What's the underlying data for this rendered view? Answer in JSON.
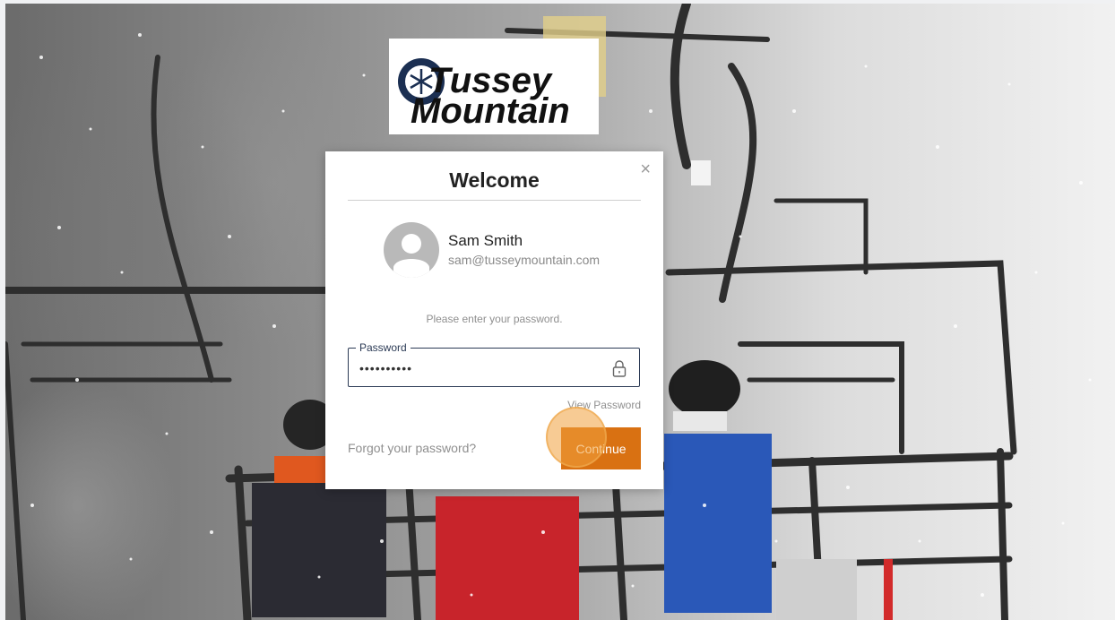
{
  "logo": {
    "line1": "Tussey",
    "line2": "Mountain"
  },
  "modal": {
    "title": "Welcome",
    "close_label": "×",
    "user": {
      "name": "Sam Smith",
      "email": "sam@tusseymountain.com"
    },
    "prompt": "Please enter your password.",
    "password": {
      "label": "Password",
      "value": "••••••••••"
    },
    "view_password_label": "View Password",
    "forgot_label": "Forgot your password?",
    "continue_label": "Continue"
  },
  "colors": {
    "accent": "#d97112",
    "field_border": "#2b3a55"
  },
  "icons": {
    "close": "close-icon",
    "avatar": "user-avatar-icon",
    "lock": "lock-icon"
  }
}
